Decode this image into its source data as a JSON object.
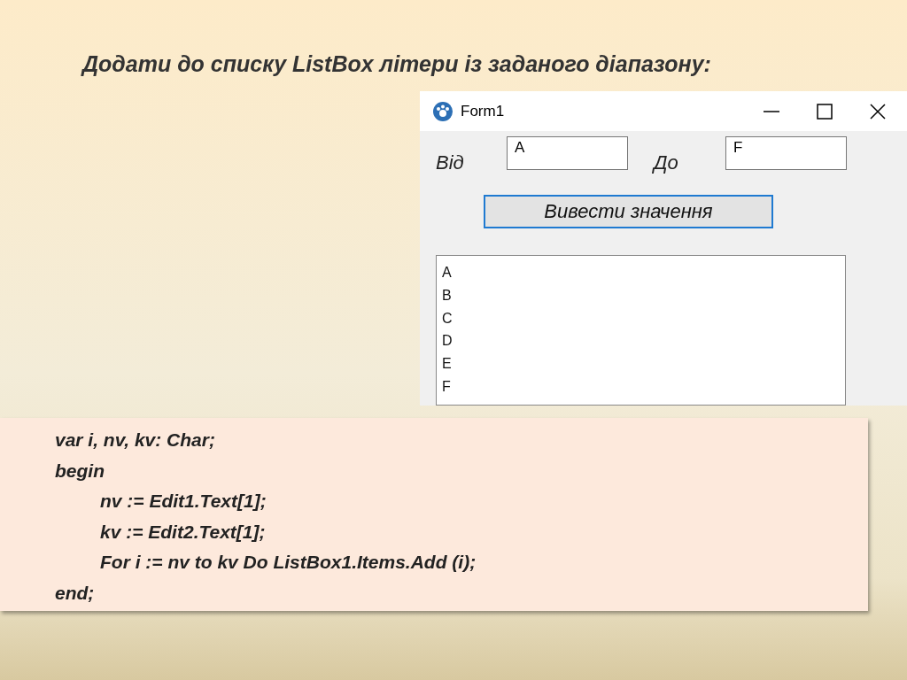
{
  "title": "Додати до списку ListBox літери із заданого діапазону:",
  "window": {
    "title": "Form1",
    "fields": [
      {
        "label": "Від",
        "value": "A"
      },
      {
        "label": "До",
        "value": "F"
      }
    ],
    "button": "Вивести значення",
    "listbox": [
      "A",
      "B",
      "C",
      "D",
      "E",
      "F"
    ]
  },
  "code": [
    {
      "text": "var i, nv, kv: Char;",
      "indented": false
    },
    {
      "text": "begin",
      "indented": false
    },
    {
      "text": "nv := Edit1.Text[1];",
      "indented": true
    },
    {
      "text": "kv := Edit2.Text[1];",
      "indented": true
    },
    {
      "text": "For i := nv to kv Do ListBox1.Items.Add (i);",
      "indented": true
    },
    {
      "text": "end;",
      "indented": false
    }
  ]
}
